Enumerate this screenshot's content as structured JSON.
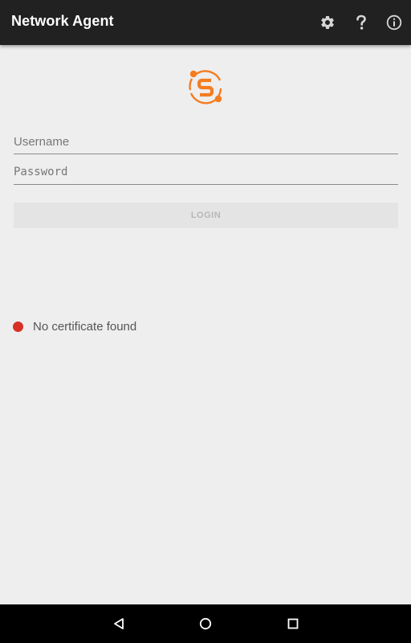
{
  "app_bar": {
    "title": "Network Agent",
    "background": "#212121",
    "actions": [
      {
        "name": "settings",
        "icon": "gear-icon"
      },
      {
        "name": "help",
        "icon": "question-mark-icon"
      },
      {
        "name": "about",
        "icon": "info-icon"
      }
    ]
  },
  "logo": {
    "icon": "s-orbit-logo",
    "color": "#f57c1f"
  },
  "form": {
    "username_placeholder": "Username",
    "password_placeholder": "Password",
    "login_label": "LOGIN"
  },
  "status": {
    "text": "No certificate found",
    "indicator_color": "#d93025"
  },
  "nav_bar": {
    "buttons": [
      {
        "name": "back",
        "icon": "triangle-back-icon"
      },
      {
        "name": "home",
        "icon": "circle-home-icon"
      },
      {
        "name": "recents",
        "icon": "square-recents-icon"
      }
    ]
  }
}
